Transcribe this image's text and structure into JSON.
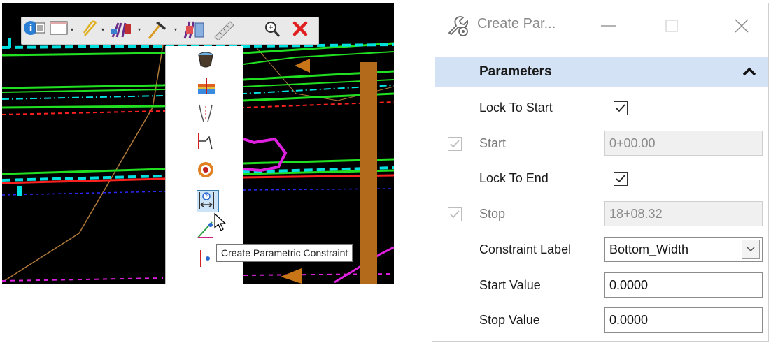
{
  "toolbar": {
    "buttons": [
      {
        "icon": "element-info-icon"
      },
      {
        "icon": "view-window-icon"
      },
      {
        "icon": "attach-reference-icon"
      },
      {
        "icon": "corridor-icon"
      },
      {
        "icon": "hammer-tool-icon"
      },
      {
        "icon": "template-drop-icon"
      },
      {
        "icon": "measure-ruler-icon"
      },
      {
        "icon": "zoom-icon"
      },
      {
        "icon": "close-x-icon"
      }
    ]
  },
  "flyout": {
    "items": [
      {
        "icon": "bucket-icon"
      },
      {
        "icon": "superelevation-icon"
      },
      {
        "icon": "transition-icon"
      },
      {
        "icon": "point-control-icon"
      },
      {
        "icon": "target-icon"
      },
      {
        "icon": "parametric-constraint-icon",
        "selected": true
      },
      {
        "icon": "curve-widening-icon"
      },
      {
        "icon": "secondary-alignment-icon"
      }
    ]
  },
  "tooltip": {
    "text": "Create Parametric Constraint"
  },
  "panel": {
    "title": "Create Par...",
    "section": "Parameters",
    "lock_to_start": {
      "label": "Lock To Start",
      "checked": true
    },
    "start": {
      "label": "Start",
      "value": "0+00.00"
    },
    "lock_to_end": {
      "label": "Lock To End",
      "checked": true
    },
    "stop": {
      "label": "Stop",
      "value": "18+08.32"
    },
    "constraint_label": {
      "label": "Constraint Label",
      "value": "Bottom_Width"
    },
    "start_value": {
      "label": "Start Value",
      "value": "0.0000"
    },
    "stop_value": {
      "label": "Stop Value",
      "value": "0.0000"
    }
  }
}
